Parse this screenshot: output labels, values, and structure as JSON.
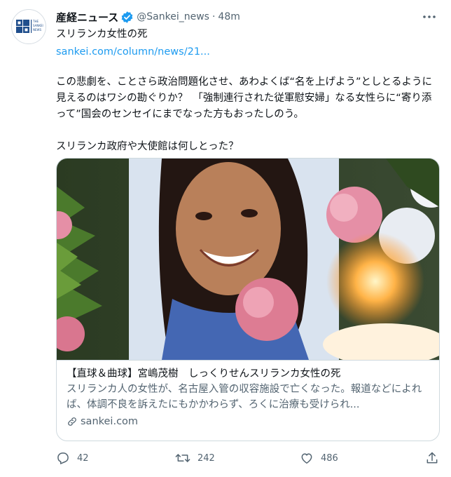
{
  "author": {
    "display_name": "産経ニュース",
    "handle": "@Sankei_news",
    "separator": "·",
    "time": "48m",
    "avatar_text": "THE SANKEI NEWS",
    "verified": true
  },
  "tweet": {
    "title": "スリランカ女性の死",
    "link": "sankei.com/column/news/21...",
    "paragraph": "この悲劇を、ことさら政治問題化させ、あわよくば“名を上げよう”としとるように見えるのはワシの勘ぐりか？　「強制連行された従軍慰安婦」なる女性らに“寄り添って”国会のセンセイにまでなった方もおったしのう。\n\nスリランカ政府や大使館は何しとった？"
  },
  "card": {
    "title": "【直球＆曲球】宮嶋茂樹　しっくりせんスリランカ女性の死",
    "description": "スリランカ人の女性が、名古屋入管の収容施設で亡くなった。報道などによれば、体調不良を訴えたにもかかわらず、ろくに治療も受けられ...",
    "domain": "sankei.com"
  },
  "actions": {
    "reply_count": "42",
    "retweet_count": "242",
    "like_count": "486"
  },
  "colors": {
    "accent": "#1d9bf0",
    "text": "#0f1419",
    "secondary": "#536471",
    "border": "#cfd9de"
  },
  "icons": [
    "more-icon",
    "verified-badge-icon",
    "link-icon",
    "reply-icon",
    "retweet-icon",
    "like-icon",
    "share-icon"
  ]
}
